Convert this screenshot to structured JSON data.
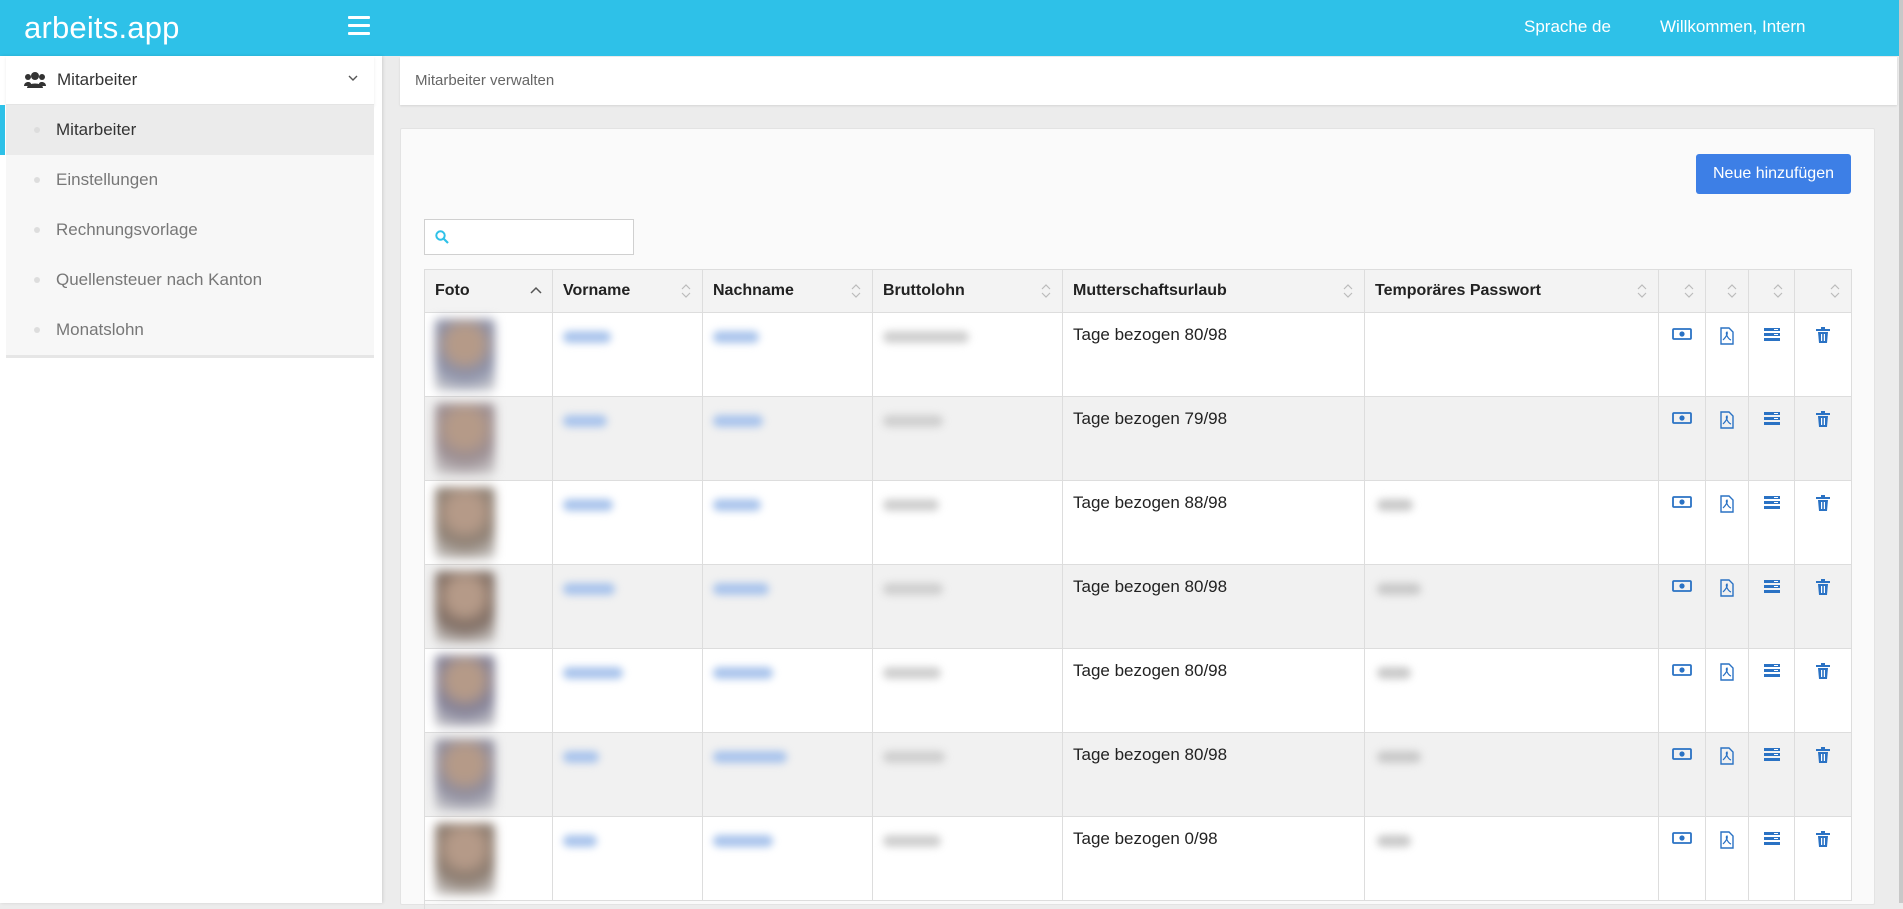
{
  "app": {
    "brand": "arbeits.app"
  },
  "topbar": {
    "language": "Sprache de",
    "welcome": "Willkommen, Intern"
  },
  "sidebar": {
    "section_label": "Mitarbeiter",
    "items": [
      {
        "label": "Mitarbeiter",
        "active": true
      },
      {
        "label": "Einstellungen",
        "active": false
      },
      {
        "label": "Rechnungsvorlage",
        "active": false
      },
      {
        "label": "Quellensteuer nach Kanton",
        "active": false
      },
      {
        "label": "Monatslohn",
        "active": false
      }
    ]
  },
  "breadcrumb": {
    "text": "Mitarbeiter verwalten"
  },
  "toolbar": {
    "add_label": "Neue hinzufügen",
    "search_placeholder": "",
    "search_value": ""
  },
  "table": {
    "columns": [
      "Foto",
      "Vorname",
      "Nachname",
      "Bruttolohn",
      "Mutterschaftsurlaub",
      "Temporäres Passwort",
      "",
      "",
      "",
      ""
    ],
    "rows": [
      {
        "maternity": "Tage bezogen 80/98"
      },
      {
        "maternity": "Tage bezogen 79/98"
      },
      {
        "maternity": "Tage bezogen 88/98"
      },
      {
        "maternity": "Tage bezogen 80/98"
      },
      {
        "maternity": "Tage bezogen 80/98"
      },
      {
        "maternity": "Tage bezogen 80/98"
      },
      {
        "maternity": "Tage bezogen 0/98"
      }
    ],
    "action_icons": [
      "salary-icon",
      "pdf-icon",
      "list-icon",
      "trash-icon"
    ]
  },
  "colors": {
    "topbar": "#2ec1e8",
    "accent": "#3d7fe6",
    "action_icon": "#2a72c4"
  }
}
